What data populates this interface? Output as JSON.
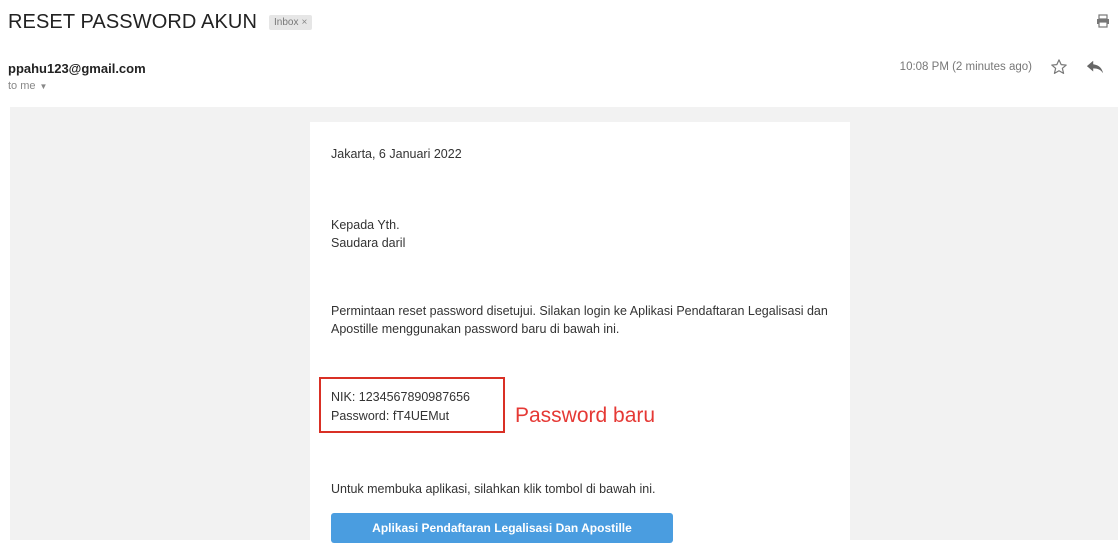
{
  "header": {
    "subject": "RESET PASSWORD AKUN",
    "label": "Inbox",
    "label_close": "×",
    "print_icon": "print-icon"
  },
  "message": {
    "sender": "ppahu123@gmail.com",
    "recipient": "to me",
    "time": "10:08 PM (2 minutes ago)",
    "star_icon": "star-icon",
    "reply_icon": "reply-icon"
  },
  "body": {
    "date_line": "Jakarta, 6 Januari 2022",
    "greeting_line1": "Kepada Yth.",
    "greeting_line2": "Saudara daril",
    "paragraph": "Permintaan reset password disetujui. Silakan login ke Aplikasi Pendaftaran Legalisasi dan Apostille menggunakan password baru di bawah ini.",
    "nik": "NIK: 1234567890987656",
    "password": "Password: fT4UEMut",
    "annotation": "Password baru",
    "instruction": "Untuk membuka aplikasi, silahkan klik tombol di bawah ini.",
    "button_label": "Aplikasi Pendaftaran Legalisasi Dan Apostille"
  },
  "colors": {
    "annotation": "#e53935",
    "button": "#4a9de0",
    "body_background": "#f2f2f2"
  }
}
